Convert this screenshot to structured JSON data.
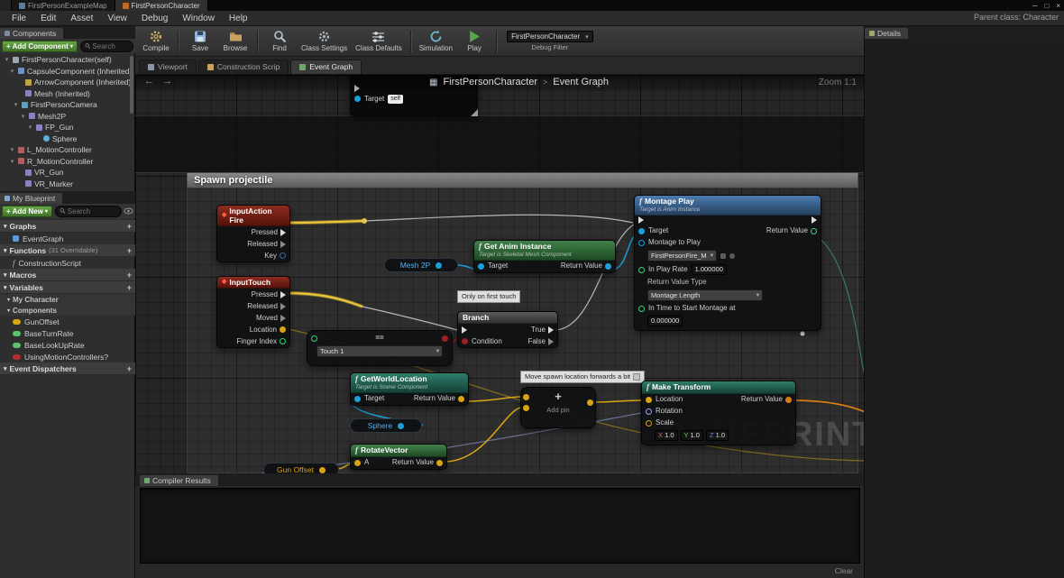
{
  "window": {
    "tab_map": "FirstPersonExampleMap",
    "tab_character": "FirstPersonCharacter",
    "minimize": "─",
    "maximize": "□",
    "close": "×"
  },
  "menu": {
    "items": [
      "File",
      "Edit",
      "Asset",
      "View",
      "Debug",
      "Window",
      "Help"
    ],
    "parent_class": "Parent class: Character"
  },
  "toolbar": {
    "compile": "Compile",
    "save": "Save",
    "browse": "Browse",
    "find": "Find",
    "class_settings": "Class Settings",
    "class_defaults": "Class Defaults",
    "simulation": "Simulation",
    "play": "Play",
    "debug_target": "FirstPersonCharacter",
    "debug_filter": "Debug Filter"
  },
  "doc_tabs": {
    "viewport": "Viewport",
    "construction": "Construction Scrip",
    "event_graph": "Event Graph"
  },
  "components": {
    "title": "Components",
    "add": "+ Add Component",
    "search": "Search",
    "items": [
      "FirstPersonCharacter(self)",
      "CapsuleComponent (Inherited)",
      "ArrowComponent (Inherited)",
      "Mesh (Inherited)",
      "FirstPersonCamera",
      "Mesh2P",
      "FP_Gun",
      "Sphere",
      "L_MotionController",
      "R_MotionController",
      "VR_Gun",
      "VR_Marker"
    ]
  },
  "my_blueprint": {
    "title": "My Blueprint",
    "add": "+ Add New",
    "search": "Search",
    "graphs": "Graphs",
    "event_graph": "EventGraph",
    "functions": "Functions",
    "functions_note": "(31 Overridable)",
    "construction_script": "ConstructionScript",
    "macros": "Macros",
    "variables": "Variables",
    "my_character": "My Character",
    "components_cat": "Components",
    "vars": [
      "GunOffset",
      "BaseTurnRate",
      "BaseLookUpRate",
      "UsingMotionControllers?"
    ],
    "event_dispatchers": "Event Dispatchers"
  },
  "details": {
    "title": "Details"
  },
  "compiler": {
    "title": "Compiler Results",
    "clear": "Clear"
  },
  "icons": {
    "back": "←",
    "forward": "→",
    "dropdown": "▾",
    "grid": "▦",
    "plus": "+",
    "diamond": "◆",
    "f": "f"
  },
  "graph": {
    "breadcrumb_root": "FirstPersonCharacter",
    "breadcrumb_sep": ">",
    "breadcrumb_current": "Event Graph",
    "zoom": "Zoom 1:1",
    "comment": "Spawn projectile",
    "watermark": "BLUEPRINT",
    "partial": {
      "target": "Target",
      "self": "self"
    },
    "nodes": {
      "iaf": {
        "title": "InputAction Fire",
        "pressed": "Pressed",
        "released": "Released",
        "key": "Key"
      },
      "touch": {
        "title": "InputTouch",
        "pressed": "Pressed",
        "released": "Released",
        "moved": "Moved",
        "location": "Location",
        "finger": "Finger Index"
      },
      "mesh2p": {
        "label": "Mesh 2P"
      },
      "gai": {
        "title": "Get Anim Instance",
        "sub": "Target is Skeletal Mesh Component",
        "target": "Target",
        "ret": "Return Value"
      },
      "first_touch": "Only on first touch",
      "branch": {
        "title": "Branch",
        "cond": "Condition",
        "t": "True",
        "f": "False"
      },
      "eq": {
        "op": "==",
        "value": "Touch 1"
      },
      "montage": {
        "title": "Montage Play",
        "sub": "Target is Anim Instance",
        "target": "Target",
        "ret": "Return Value",
        "play_label": "Montage to Play",
        "play_value": "FirstPersonFire_M",
        "rate_label": "In Play Rate",
        "rate_value": "1.000000",
        "rvt_label": "Return Value Type",
        "rvt_value": "Montage Length",
        "time_label": "In Time to Start Montage at",
        "time_value": "0.000000"
      },
      "gwl": {
        "title": "GetWorldLocation",
        "sub": "Target is Scene Component",
        "target": "Target",
        "ret": "Return Value"
      },
      "sphere": {
        "label": "Sphere"
      },
      "rot": {
        "title": "RotateVector",
        "a": "A",
        "ret": "Return Value"
      },
      "gun_offset": {
        "label": "Gun Offset"
      },
      "move_comment": "Move spawn location forwards a bit",
      "add": {
        "plus": "+",
        "label": "Add pin"
      },
      "mt": {
        "title": "Make Transform",
        "location": "Location",
        "rotation": "Rotation",
        "scale": "Scale",
        "ret": "Return Value",
        "x": "X",
        "xv": "1.0",
        "y": "Y",
        "yv": "1.0",
        "z": "Z",
        "zv": "1.0"
      }
    }
  },
  "colors": {
    "exec_pin": "#dcdcdc",
    "object_pin": "#1c9ed9",
    "bool_pin": "#9c2020",
    "vector_pin": "#d9a514",
    "float_pin": "#3fd17a",
    "event_header": "#8c2c20",
    "function_header": "#41814a",
    "montage_header": "#4d7bb0",
    "green_button": "#68a847",
    "selected_wire": "#e8c438"
  }
}
